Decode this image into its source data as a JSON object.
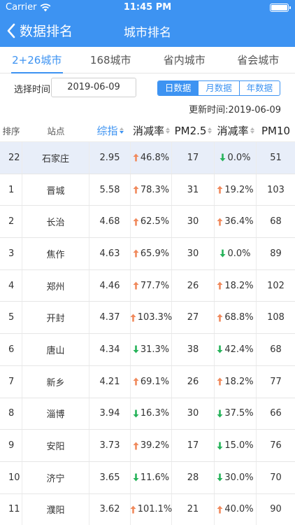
{
  "status_bar": {
    "carrier": "Carrier",
    "time": "11:45 PM"
  },
  "nav": {
    "back_label": "数据排名",
    "title": "城市排名"
  },
  "tabs": [
    {
      "label": "2+26城市",
      "active": true
    },
    {
      "label": "168城市",
      "active": false
    },
    {
      "label": "省内城市",
      "active": false
    },
    {
      "label": "省会城市",
      "active": false
    }
  ],
  "filter": {
    "date_label": "选择时间:",
    "date_value": "2019-06-09",
    "segments": [
      {
        "label": "日数据",
        "active": true
      },
      {
        "label": "月数据",
        "active": false
      },
      {
        "label": "年数据",
        "active": false
      }
    ],
    "update_text": "更新时间:2019-06-09"
  },
  "table": {
    "headers": [
      "排序",
      "站点",
      "综指",
      "消减率",
      "PM2.5",
      "消减率",
      "PM10"
    ],
    "rows": [
      {
        "rank": "22",
        "station": "石家庄",
        "index": "2.95",
        "rate1": "46.8%",
        "trend1": "up",
        "pm25": "17",
        "rate2": "0.0%",
        "trend2": "down",
        "pm10": "51",
        "highlight": true
      },
      {
        "rank": "1",
        "station": "晋城",
        "index": "5.58",
        "rate1": "78.3%",
        "trend1": "up",
        "pm25": "31",
        "rate2": "19.2%",
        "trend2": "up",
        "pm10": "103"
      },
      {
        "rank": "2",
        "station": "长治",
        "index": "4.68",
        "rate1": "62.5%",
        "trend1": "up",
        "pm25": "30",
        "rate2": "36.4%",
        "trend2": "up",
        "pm10": "68"
      },
      {
        "rank": "3",
        "station": "焦作",
        "index": "4.63",
        "rate1": "65.9%",
        "trend1": "up",
        "pm25": "30",
        "rate2": "0.0%",
        "trend2": "down",
        "pm10": "89"
      },
      {
        "rank": "4",
        "station": "郑州",
        "index": "4.46",
        "rate1": "77.7%",
        "trend1": "up",
        "pm25": "26",
        "rate2": "18.2%",
        "trend2": "up",
        "pm10": "102"
      },
      {
        "rank": "5",
        "station": "开封",
        "index": "4.37",
        "rate1": "103.3%",
        "trend1": "up",
        "pm25": "27",
        "rate2": "68.8%",
        "trend2": "up",
        "pm10": "108"
      },
      {
        "rank": "6",
        "station": "唐山",
        "index": "4.34",
        "rate1": "31.3%",
        "trend1": "down",
        "pm25": "38",
        "rate2": "42.4%",
        "trend2": "down",
        "pm10": "68"
      },
      {
        "rank": "7",
        "station": "新乡",
        "index": "4.21",
        "rate1": "69.1%",
        "trend1": "up",
        "pm25": "26",
        "rate2": "18.2%",
        "trend2": "up",
        "pm10": "77"
      },
      {
        "rank": "8",
        "station": "淄博",
        "index": "3.94",
        "rate1": "16.3%",
        "trend1": "down",
        "pm25": "30",
        "rate2": "37.5%",
        "trend2": "down",
        "pm10": "66"
      },
      {
        "rank": "9",
        "station": "安阳",
        "index": "3.73",
        "rate1": "39.2%",
        "trend1": "up",
        "pm25": "17",
        "rate2": "15.0%",
        "trend2": "down",
        "pm10": "76"
      },
      {
        "rank": "10",
        "station": "济宁",
        "index": "3.65",
        "rate1": "11.6%",
        "trend1": "down",
        "pm25": "28",
        "rate2": "30.0%",
        "trend2": "down",
        "pm10": "70"
      },
      {
        "rank": "11",
        "station": "濮阳",
        "index": "3.62",
        "rate1": "101.1%",
        "trend1": "up",
        "pm25": "21",
        "rate2": "40.0%",
        "trend2": "up",
        "pm10": "90"
      }
    ]
  },
  "colors": {
    "accent": "#3d93f2",
    "up": "#f08a5d",
    "down": "#27b35a",
    "highlight_row": "#e8eef9"
  },
  "icons": {
    "up": "arrow-up-icon",
    "down": "arrow-down-icon",
    "back": "chevron-left-icon"
  }
}
